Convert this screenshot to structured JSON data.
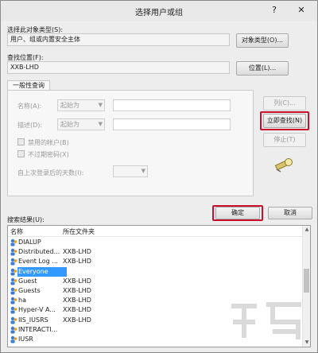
{
  "window": {
    "title": "选择用户或组",
    "help_glyph": "?",
    "close_glyph": "✕"
  },
  "object_type": {
    "label": "选择此对象类型(S):",
    "value": "用户、组或内置安全主体",
    "button": "对象类型(O)..."
  },
  "location": {
    "label": "查找位置(F):",
    "value": "XXB-LHD",
    "button": "位置(L)..."
  },
  "query": {
    "tab": "一般性查询",
    "name_label": "名称(A):",
    "desc_label": "描述(D):",
    "starts_with": "起始为",
    "disabled_accounts": "禁用的帐户(B)",
    "non_expiring": "不过期密码(X)",
    "days_label": "自上次登录后的天数(I):"
  },
  "side_buttons": {
    "columns": "列(C)...",
    "find_now": "立即查找(N)",
    "stop": "停止(T)"
  },
  "search_results_label": "搜索结果(U):",
  "ok": "确定",
  "cancel": "取消",
  "results": {
    "columns": [
      "名称",
      "所在文件夹"
    ],
    "rows": [
      {
        "name": "DIALUP",
        "folder": ""
      },
      {
        "name": "Distributed...",
        "folder": "XXB-LHD"
      },
      {
        "name": "Event Log ...",
        "folder": "XXB-LHD"
      },
      {
        "name": "Everyone",
        "folder": ""
      },
      {
        "name": "Guest",
        "folder": "XXB-LHD"
      },
      {
        "name": "Guests",
        "folder": "XXB-LHD"
      },
      {
        "name": "ha",
        "folder": "XXB-LHD"
      },
      {
        "name": "Hyper-V A...",
        "folder": "XXB-LHD"
      },
      {
        "name": "IIS_IUSRS",
        "folder": "XXB-LHD"
      },
      {
        "name": "INTERACTI...",
        "folder": ""
      },
      {
        "name": "IUSR",
        "folder": ""
      }
    ],
    "selected_index": 3
  },
  "colors": {
    "highlight": "#c8102e",
    "selection": "#3399ff"
  }
}
